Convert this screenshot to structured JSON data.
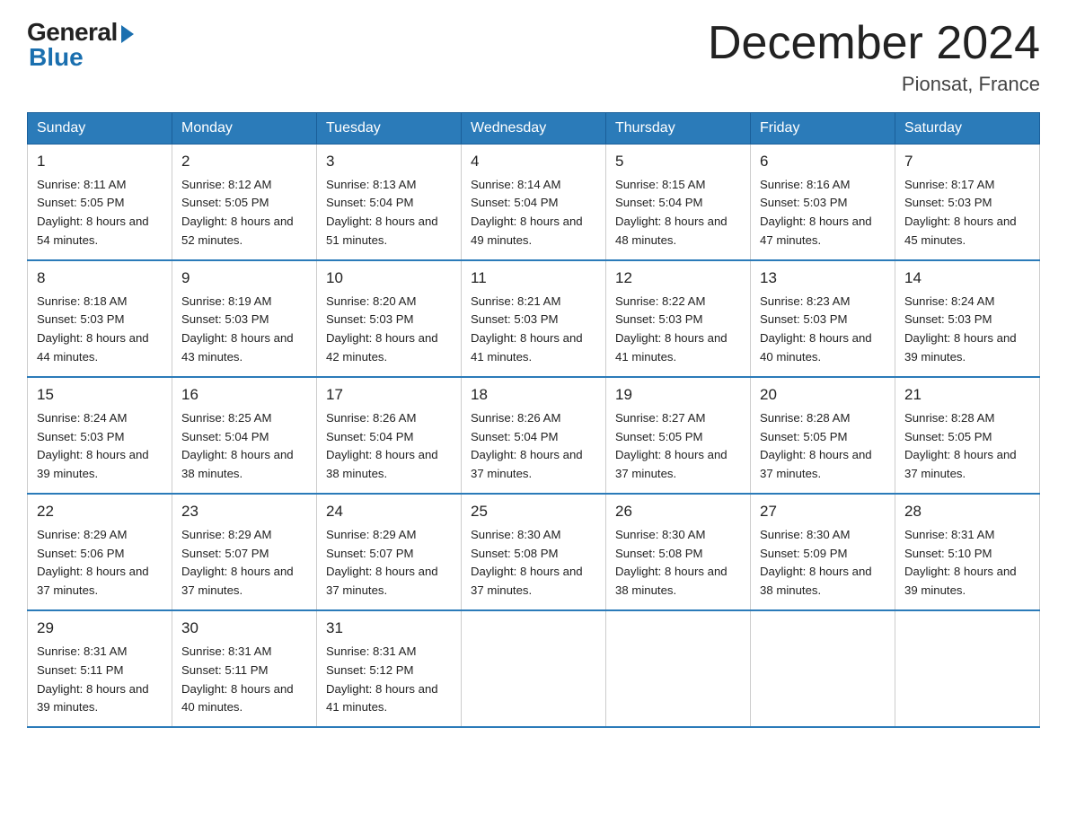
{
  "logo": {
    "general": "General",
    "blue": "Blue"
  },
  "title": "December 2024",
  "location": "Pionsat, France",
  "days_of_week": [
    "Sunday",
    "Monday",
    "Tuesday",
    "Wednesday",
    "Thursday",
    "Friday",
    "Saturday"
  ],
  "weeks": [
    [
      {
        "day": "1",
        "sunrise": "8:11 AM",
        "sunset": "5:05 PM",
        "daylight": "8 hours and 54 minutes."
      },
      {
        "day": "2",
        "sunrise": "8:12 AM",
        "sunset": "5:05 PM",
        "daylight": "8 hours and 52 minutes."
      },
      {
        "day": "3",
        "sunrise": "8:13 AM",
        "sunset": "5:04 PM",
        "daylight": "8 hours and 51 minutes."
      },
      {
        "day": "4",
        "sunrise": "8:14 AM",
        "sunset": "5:04 PM",
        "daylight": "8 hours and 49 minutes."
      },
      {
        "day": "5",
        "sunrise": "8:15 AM",
        "sunset": "5:04 PM",
        "daylight": "8 hours and 48 minutes."
      },
      {
        "day": "6",
        "sunrise": "8:16 AM",
        "sunset": "5:03 PM",
        "daylight": "8 hours and 47 minutes."
      },
      {
        "day": "7",
        "sunrise": "8:17 AM",
        "sunset": "5:03 PM",
        "daylight": "8 hours and 45 minutes."
      }
    ],
    [
      {
        "day": "8",
        "sunrise": "8:18 AM",
        "sunset": "5:03 PM",
        "daylight": "8 hours and 44 minutes."
      },
      {
        "day": "9",
        "sunrise": "8:19 AM",
        "sunset": "5:03 PM",
        "daylight": "8 hours and 43 minutes."
      },
      {
        "day": "10",
        "sunrise": "8:20 AM",
        "sunset": "5:03 PM",
        "daylight": "8 hours and 42 minutes."
      },
      {
        "day": "11",
        "sunrise": "8:21 AM",
        "sunset": "5:03 PM",
        "daylight": "8 hours and 41 minutes."
      },
      {
        "day": "12",
        "sunrise": "8:22 AM",
        "sunset": "5:03 PM",
        "daylight": "8 hours and 41 minutes."
      },
      {
        "day": "13",
        "sunrise": "8:23 AM",
        "sunset": "5:03 PM",
        "daylight": "8 hours and 40 minutes."
      },
      {
        "day": "14",
        "sunrise": "8:24 AM",
        "sunset": "5:03 PM",
        "daylight": "8 hours and 39 minutes."
      }
    ],
    [
      {
        "day": "15",
        "sunrise": "8:24 AM",
        "sunset": "5:03 PM",
        "daylight": "8 hours and 39 minutes."
      },
      {
        "day": "16",
        "sunrise": "8:25 AM",
        "sunset": "5:04 PM",
        "daylight": "8 hours and 38 minutes."
      },
      {
        "day": "17",
        "sunrise": "8:26 AM",
        "sunset": "5:04 PM",
        "daylight": "8 hours and 38 minutes."
      },
      {
        "day": "18",
        "sunrise": "8:26 AM",
        "sunset": "5:04 PM",
        "daylight": "8 hours and 37 minutes."
      },
      {
        "day": "19",
        "sunrise": "8:27 AM",
        "sunset": "5:05 PM",
        "daylight": "8 hours and 37 minutes."
      },
      {
        "day": "20",
        "sunrise": "8:28 AM",
        "sunset": "5:05 PM",
        "daylight": "8 hours and 37 minutes."
      },
      {
        "day": "21",
        "sunrise": "8:28 AM",
        "sunset": "5:05 PM",
        "daylight": "8 hours and 37 minutes."
      }
    ],
    [
      {
        "day": "22",
        "sunrise": "8:29 AM",
        "sunset": "5:06 PM",
        "daylight": "8 hours and 37 minutes."
      },
      {
        "day": "23",
        "sunrise": "8:29 AM",
        "sunset": "5:07 PM",
        "daylight": "8 hours and 37 minutes."
      },
      {
        "day": "24",
        "sunrise": "8:29 AM",
        "sunset": "5:07 PM",
        "daylight": "8 hours and 37 minutes."
      },
      {
        "day": "25",
        "sunrise": "8:30 AM",
        "sunset": "5:08 PM",
        "daylight": "8 hours and 37 minutes."
      },
      {
        "day": "26",
        "sunrise": "8:30 AM",
        "sunset": "5:08 PM",
        "daylight": "8 hours and 38 minutes."
      },
      {
        "day": "27",
        "sunrise": "8:30 AM",
        "sunset": "5:09 PM",
        "daylight": "8 hours and 38 minutes."
      },
      {
        "day": "28",
        "sunrise": "8:31 AM",
        "sunset": "5:10 PM",
        "daylight": "8 hours and 39 minutes."
      }
    ],
    [
      {
        "day": "29",
        "sunrise": "8:31 AM",
        "sunset": "5:11 PM",
        "daylight": "8 hours and 39 minutes."
      },
      {
        "day": "30",
        "sunrise": "8:31 AM",
        "sunset": "5:11 PM",
        "daylight": "8 hours and 40 minutes."
      },
      {
        "day": "31",
        "sunrise": "8:31 AM",
        "sunset": "5:12 PM",
        "daylight": "8 hours and 41 minutes."
      },
      null,
      null,
      null,
      null
    ]
  ]
}
